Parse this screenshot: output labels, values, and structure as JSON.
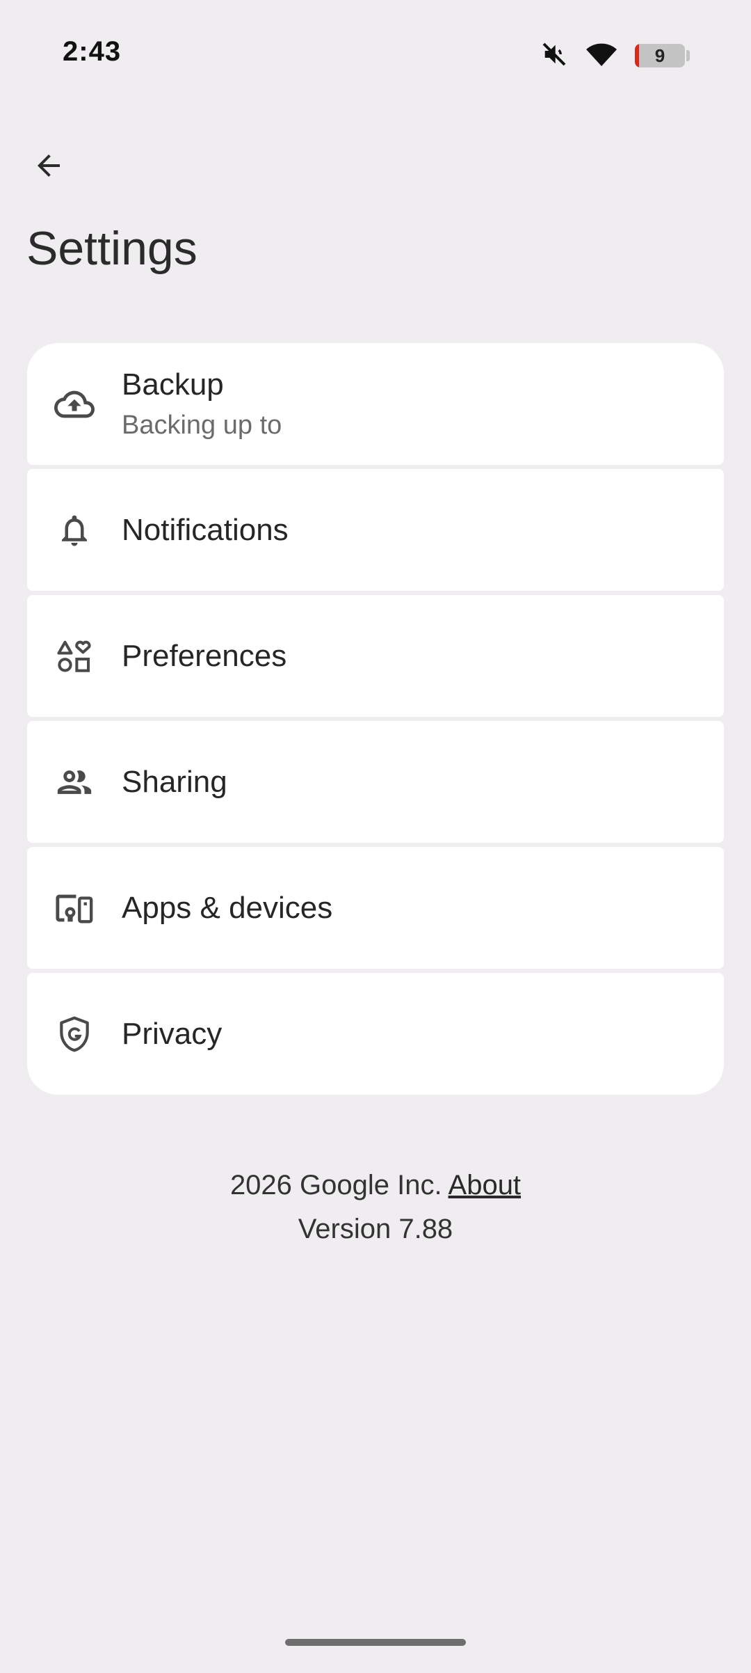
{
  "status_bar": {
    "time": "2:43",
    "battery_level": "9",
    "battery_fraction": 0.09,
    "icons": [
      "mute-icon",
      "wifi-icon",
      "battery-icon"
    ]
  },
  "header": {
    "back_icon": "arrow-back-icon",
    "title": "Settings"
  },
  "settings_items": [
    {
      "icon": "cloud-upload-icon",
      "label": "Backup",
      "sub": "Backing up to"
    },
    {
      "icon": "bell-icon",
      "label": "Notifications"
    },
    {
      "icon": "shapes-heart-icon",
      "label": "Preferences"
    },
    {
      "icon": "people-icon",
      "label": "Sharing"
    },
    {
      "icon": "devices-icon",
      "label": "Apps & devices"
    },
    {
      "icon": "shield-g-icon",
      "label": "Privacy"
    }
  ],
  "footer": {
    "copyright": "2026 Google Inc.",
    "about_link": "About",
    "version": "Version 7.88"
  },
  "colors": {
    "background": "#efedef",
    "card": "#ffffff",
    "battery_low": "#e0251b"
  }
}
